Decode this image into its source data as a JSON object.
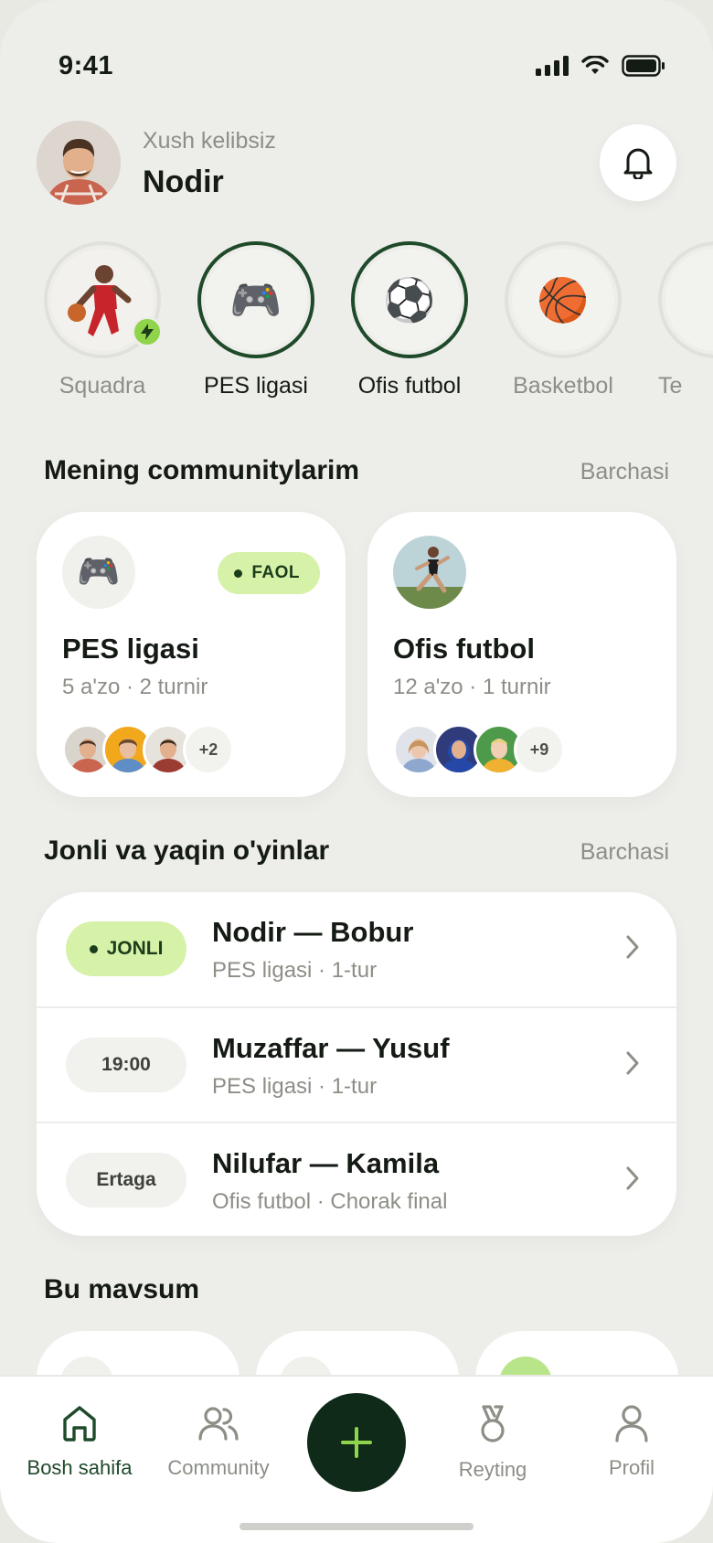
{
  "status_bar": {
    "time": "9:41"
  },
  "header": {
    "greeting": "Xush kelibsiz",
    "user_name": "Nodir"
  },
  "stories": [
    {
      "label": "Squadra",
      "icon": "basketball-player-photo",
      "active": false
    },
    {
      "label": "PES ligasi",
      "icon": "🎮",
      "active": true
    },
    {
      "label": "Ofis futbol",
      "icon": "⚽",
      "active": true
    },
    {
      "label": "Basketbol",
      "icon": "🏀",
      "active": false
    },
    {
      "label": "Te",
      "icon": "",
      "active": false
    }
  ],
  "communities_section": {
    "title": "Mening communitylarim",
    "link": "Barchasi"
  },
  "communities": [
    {
      "name": "PES ligasi",
      "meta": "5 a'zo · 2 turnir",
      "icon": "🎮",
      "badge": "FAOL",
      "more": "+2"
    },
    {
      "name": "Ofis futbol",
      "meta": "12 a'zo · 1 turnir",
      "icon": "runner-photo",
      "badge": "",
      "more": "+9"
    }
  ],
  "matches_section": {
    "title": "Jonli va yaqin o'yinlar",
    "link": "Barchasi"
  },
  "matches": [
    {
      "pill": "JONLI",
      "live": true,
      "title": "Nodir  —  Bobur",
      "sub": "PES ligasi · 1-tur"
    },
    {
      "pill": "19:00",
      "live": false,
      "title": "Muzaffar  —  Yusuf",
      "sub": "PES ligasi · 1-tur"
    },
    {
      "pill": "Ertaga",
      "live": false,
      "title": "Nilufar  —  Kamila",
      "sub": "Ofis futbol · Chorak final"
    }
  ],
  "season_section": {
    "title": "Bu mavsum"
  },
  "tabbar": {
    "home": "Bosh sahifa",
    "community": "Community",
    "rating": "Reyting",
    "profile": "Profil"
  },
  "colors": {
    "accent": "#1f4a2a",
    "live_bg": "#d6f2a8",
    "fab": "#0f2a18",
    "plus": "#8fd44a"
  }
}
